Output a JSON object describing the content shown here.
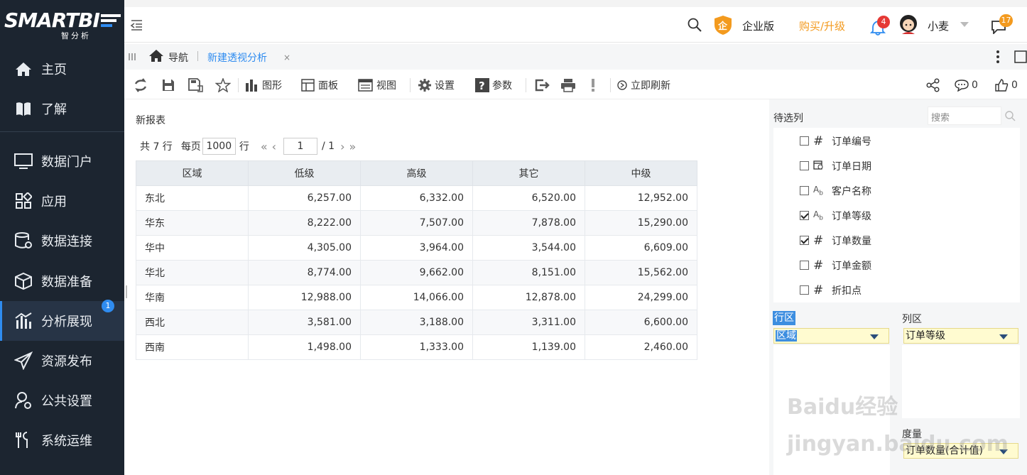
{
  "app": {
    "logo_text": "SMARTBI",
    "logo_sub": "智分析"
  },
  "sidebar": {
    "items": [
      {
        "label": "主页",
        "icon": "home-icon"
      },
      {
        "label": "了解",
        "icon": "book-icon"
      },
      {
        "label": "数据门户",
        "icon": "monitor-icon"
      },
      {
        "label": "应用",
        "icon": "apps-icon"
      },
      {
        "label": "数据连接",
        "icon": "database-icon"
      },
      {
        "label": "数据准备",
        "icon": "cube-icon"
      },
      {
        "label": "分析展现",
        "icon": "chart-icon",
        "badge": "1"
      },
      {
        "label": "资源发布",
        "icon": "send-icon"
      },
      {
        "label": "公共设置",
        "icon": "settings-user-icon"
      },
      {
        "label": "系统运维",
        "icon": "tools-icon"
      }
    ]
  },
  "topbar": {
    "edition": "企业版",
    "edition_icon": "企",
    "upgrade": "购买/升级",
    "notify_count": "4",
    "user": "小麦",
    "msg_count": "17"
  },
  "tabs": {
    "home": "导航",
    "current": "新建透视分析",
    "close": "×"
  },
  "toolbar": {
    "chart": "图形",
    "panel": "面板",
    "view": "视图",
    "settings": "设置",
    "params": "参数",
    "refresh": "立即刷新",
    "comments": "0",
    "likes": "0"
  },
  "report": {
    "title": "新报表",
    "pager": {
      "total": "共 7 行",
      "per_page_label": "每页",
      "per_page": "1000",
      "rows_unit": "行",
      "page": "1",
      "page_total": "/ 1"
    },
    "columns": [
      "区域",
      "低级",
      "高级",
      "其它",
      "中级"
    ],
    "rows": [
      [
        "东北",
        "6,257.00",
        "6,332.00",
        "6,520.00",
        "12,952.00"
      ],
      [
        "华东",
        "8,222.00",
        "7,507.00",
        "7,878.00",
        "15,290.00"
      ],
      [
        "华中",
        "4,305.00",
        "3,964.00",
        "3,544.00",
        "6,609.00"
      ],
      [
        "华北",
        "8,774.00",
        "9,662.00",
        "8,151.00",
        "15,562.00"
      ],
      [
        "华南",
        "12,988.00",
        "14,066.00",
        "12,878.00",
        "24,299.00"
      ],
      [
        "西北",
        "3,581.00",
        "3,188.00",
        "3,311.00",
        "6,600.00"
      ],
      [
        "西南",
        "1,498.00",
        "1,333.00",
        "1,139.00",
        "2,460.00"
      ]
    ]
  },
  "panel": {
    "title": "待选列",
    "search_placeholder": "搜索",
    "fields": [
      {
        "label": "订单编号",
        "type": "#",
        "checked": false
      },
      {
        "label": "订单日期",
        "type": "date",
        "checked": false
      },
      {
        "label": "客户名称",
        "type": "Ab",
        "checked": false
      },
      {
        "label": "订单等级",
        "type": "Ab",
        "checked": true
      },
      {
        "label": "订单数量",
        "type": "#",
        "checked": true
      },
      {
        "label": "订单金额",
        "type": "#",
        "checked": false
      },
      {
        "label": "折扣点",
        "type": "#",
        "checked": false
      }
    ],
    "row_area": {
      "label": "行区",
      "value": "区域"
    },
    "col_area": {
      "label": "列区",
      "value": "订单等级"
    },
    "measure": {
      "label": "度量",
      "value": "订单数量(合计值)"
    }
  },
  "watermark": "Baidu经验 jingyan.baidu.com"
}
